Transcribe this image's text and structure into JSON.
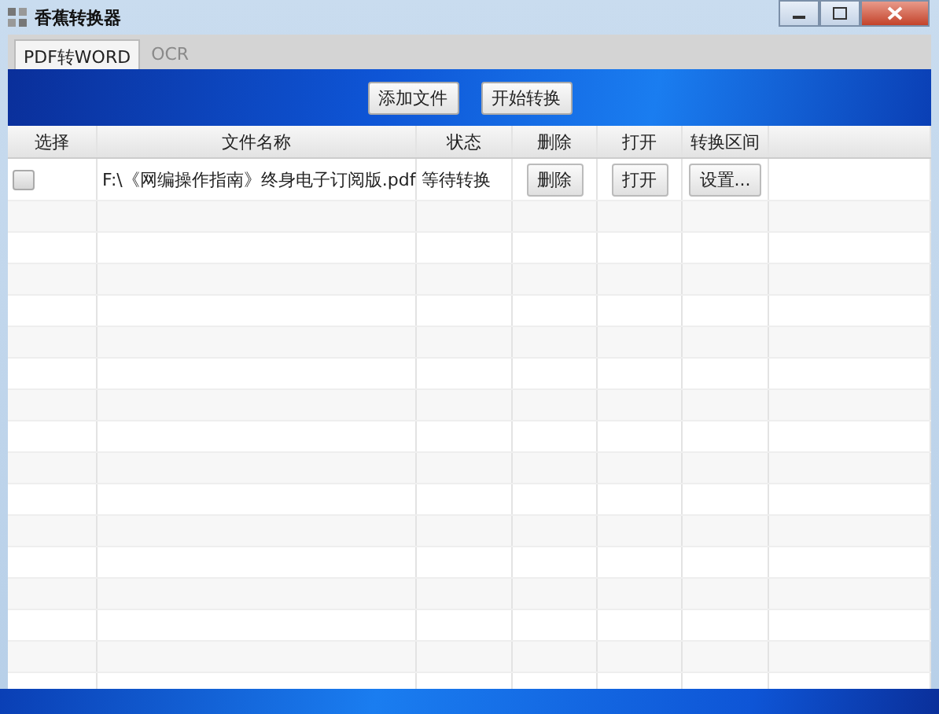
{
  "window": {
    "title": "香蕉转换器"
  },
  "tabs": [
    {
      "label": "PDF转WORD",
      "selected": true
    },
    {
      "label": "OCR",
      "selected": false
    }
  ],
  "toolbar": {
    "buttons": [
      "添加文件",
      "开始转换"
    ]
  },
  "table": {
    "columns": [
      "选择",
      "文件名称",
      "状态",
      "删除",
      "打开",
      "转换区间"
    ],
    "rows": [
      {
        "checked": false,
        "file": "F:\\《网编操作指南》终身电子订阅版.pdf",
        "status": "等待转换",
        "delete": "删除",
        "open": "打开",
        "range": "设置..."
      }
    ]
  }
}
